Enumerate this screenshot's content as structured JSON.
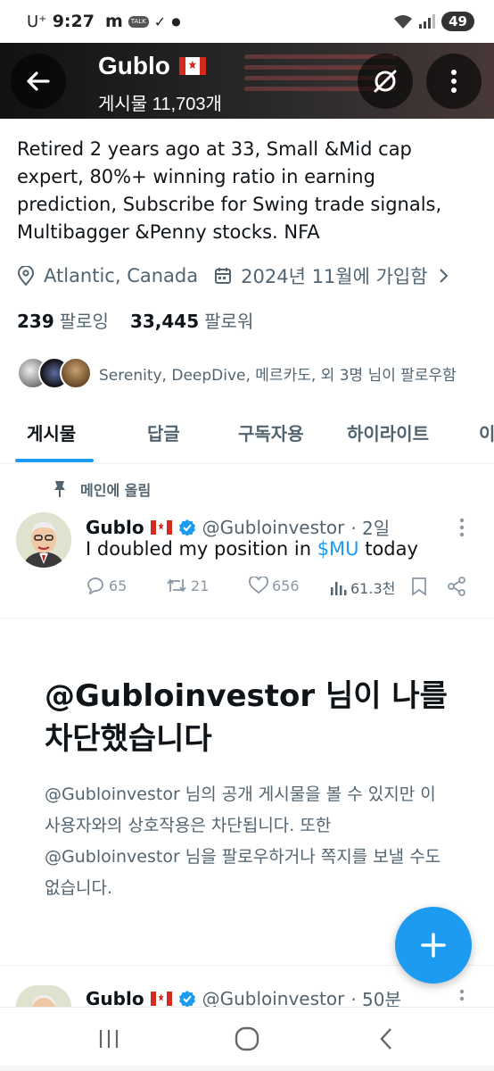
{
  "status_bar": {
    "carrier": "U⁺",
    "time": "9:27",
    "app_m": "m",
    "talk": "TALK",
    "battery": "49",
    "network": "6"
  },
  "header": {
    "name": "Gublo",
    "posts_count": "게시물 11,703개"
  },
  "profile": {
    "bio": "Retired 2 years ago at 33, Small &Mid cap expert, 80%+ winning ratio in earning prediction, Subscribe for Swing trade signals, Multibagger &Penny stocks. NFA",
    "location": "Atlantic, Canada",
    "joined": "2024년 11월에 가입함",
    "following_count": "239",
    "following_label": "팔로잉",
    "followers_count": "33,445",
    "followers_label": "팔로워",
    "followed_by": "Serenity, DeepDive, 메르카도, 외 3명 님이 팔로우함"
  },
  "tabs": [
    {
      "label": "게시물",
      "active": true
    },
    {
      "label": "답글",
      "active": false
    },
    {
      "label": "구독자용",
      "active": false
    },
    {
      "label": "하이라이트",
      "active": false
    },
    {
      "label": "이",
      "active": false
    }
  ],
  "pinned_tweet": {
    "pinned_label": "메인에 올림",
    "name": "Gublo",
    "handle": "@Gubloinvestor",
    "time": "· 2일",
    "text_before": "I doubled my position in ",
    "cashtag": "$MU",
    "text_after": " today",
    "replies": "65",
    "retweets": "21",
    "likes": "656",
    "views": "61.3천"
  },
  "blocked_notice": {
    "title": "@Gubloinvestor 님이 나를 차단했습니다",
    "description": "@Gubloinvestor 님의 공개 게시물을 볼 수 있지만 이 사용자와의 상호작용은 차단됩니다. 또한 @Gubloinvestor 님을 팔로우하거나 쪽지를 보낼 수도 없습니다."
  },
  "second_tweet": {
    "name": "Gublo",
    "handle": "@Gubloinvestor",
    "time": "· 50분"
  },
  "colors": {
    "accent": "#1d9bf0",
    "text_primary": "#0f1419",
    "text_secondary": "#536471"
  }
}
